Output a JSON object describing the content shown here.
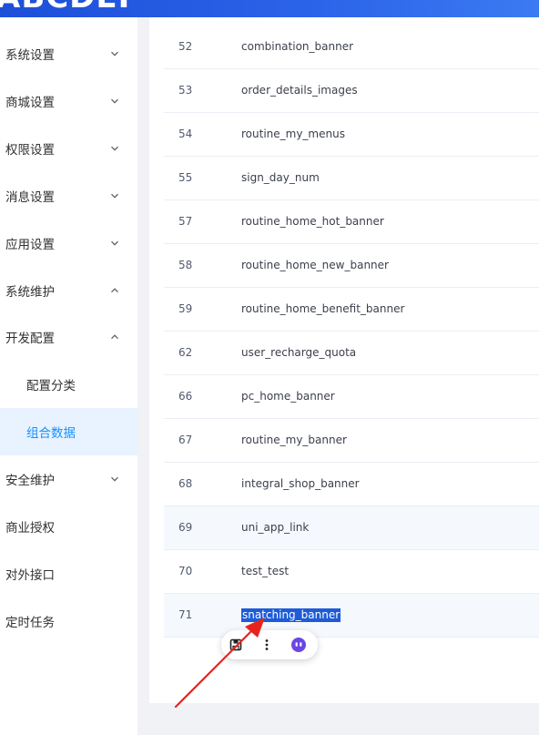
{
  "brand": {
    "logo_text": "ABCDEF"
  },
  "sidebar": {
    "items": [
      {
        "label": "系统设置",
        "chevron": "down"
      },
      {
        "label": "商城设置",
        "chevron": "down"
      },
      {
        "label": "权限设置",
        "chevron": "down"
      },
      {
        "label": "消息设置",
        "chevron": "down"
      },
      {
        "label": "应用设置",
        "chevron": "down"
      },
      {
        "label": "系统维护",
        "chevron": "up"
      },
      {
        "label": "开发配置",
        "chevron": "up"
      },
      {
        "label": "配置分类",
        "sub": true
      },
      {
        "label": "组合数据",
        "sub": true,
        "active": true
      },
      {
        "label": "安全维护",
        "chevron": "down"
      },
      {
        "label": "商业授权"
      },
      {
        "label": "对外接口"
      },
      {
        "label": "定时任务"
      }
    ]
  },
  "table": {
    "rows": [
      {
        "id": "52",
        "key": "combination_banner"
      },
      {
        "id": "53",
        "key": "order_details_images"
      },
      {
        "id": "54",
        "key": "routine_my_menus"
      },
      {
        "id": "55",
        "key": "sign_day_num"
      },
      {
        "id": "57",
        "key": "routine_home_hot_banner"
      },
      {
        "id": "58",
        "key": "routine_home_new_banner"
      },
      {
        "id": "59",
        "key": "routine_home_benefit_banner"
      },
      {
        "id": "62",
        "key": "user_recharge_quota"
      },
      {
        "id": "66",
        "key": "pc_home_banner"
      },
      {
        "id": "67",
        "key": "routine_my_banner"
      },
      {
        "id": "68",
        "key": "integral_shop_banner"
      },
      {
        "id": "69",
        "key": "uni_app_link",
        "highlighted": true
      },
      {
        "id": "70",
        "key": "test_test"
      },
      {
        "id": "71",
        "key": "snatching_banner",
        "highlighted": true,
        "selected": true
      }
    ]
  },
  "selection_popup": {
    "icons": [
      "save-icon",
      "more-vertical-icon",
      "assistant-icon"
    ]
  },
  "colors": {
    "accent": "#1890ff",
    "header": "#1d4fd8",
    "annotation_arrow": "#e8231e",
    "selection": "#1e5bd7"
  }
}
